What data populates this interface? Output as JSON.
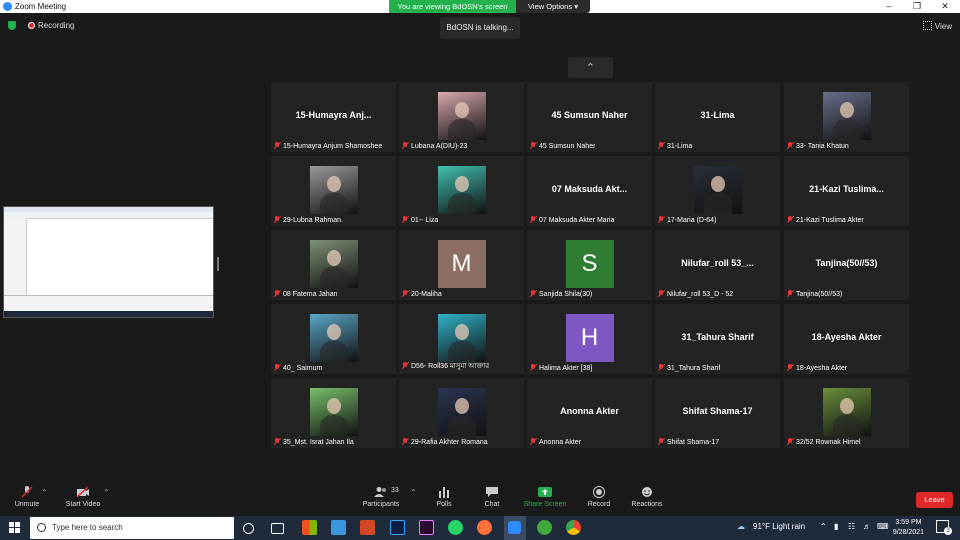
{
  "window": {
    "title": "Zoom Meeting"
  },
  "banner": {
    "text": "You are viewing BdOSN's screen",
    "view_options": "View Options"
  },
  "status": {
    "recording": "Recording",
    "talking": "BdOSN is talking...",
    "view": "View"
  },
  "tiles": [
    {
      "display": "15-Humayra  Anj...",
      "label": "15-Humayra Anjum Shamoshee",
      "type": "name"
    },
    {
      "display": "",
      "label": "Lubana A(DIU)-23",
      "type": "photo",
      "color": "#d9a8b0"
    },
    {
      "display": "45 Sumsun Naher",
      "label": "45 Sumsun Naher",
      "type": "name"
    },
    {
      "display": "31-Lima",
      "label": "31-Lima",
      "type": "name"
    },
    {
      "display": "",
      "label": "33- Tania Khatun",
      "type": "photo",
      "color": "#6a6f8a"
    },
    {
      "display": "",
      "label": "29-Lubna Rahman.",
      "type": "photo",
      "color": "#9a9a9a"
    },
    {
      "display": "",
      "label": "01-- Liza",
      "type": "photo",
      "color": "#3fc1b0"
    },
    {
      "display": "07 Maksuda  Akt...",
      "label": "07 Maksuda Akter Maria",
      "type": "name"
    },
    {
      "display": "",
      "label": "17-Maria (D-64)",
      "type": "photo",
      "color": "#2a2f38"
    },
    {
      "display": "21-Kazi  Tuslima...",
      "label": "21-Kazi Tuslima Akter",
      "type": "name"
    },
    {
      "display": "",
      "label": "08 Fatema Jahan",
      "type": "photo",
      "color": "#7e8f77"
    },
    {
      "display": "M",
      "label": "20-Maliha",
      "type": "initial",
      "color": "#8d6e63"
    },
    {
      "display": "S",
      "label": "Sanjida Shila(30)",
      "type": "initial",
      "color": "#2e7d32"
    },
    {
      "display": "Nilufar_roll  53_...",
      "label": "Nilufar_roll 53_D - 52",
      "type": "name"
    },
    {
      "display": "Tanjina(50//53)",
      "label": "Tanjina(50//53)",
      "type": "name"
    },
    {
      "display": "",
      "label": "40_ Saimum",
      "type": "photo",
      "color": "#5aa7c8"
    },
    {
      "display": "",
      "label": "D56- Roll36 মাসুমা আক্তার",
      "type": "photo",
      "color": "#2fb3c9"
    },
    {
      "display": "H",
      "label": "Halima Akter [38]",
      "type": "initial",
      "color": "#7e57c2"
    },
    {
      "display": "31_Tahura Sharif",
      "label": "31_Tahura Sharif",
      "type": "name"
    },
    {
      "display": "18-Ayesha Akter",
      "label": "18-Ayesha Akter",
      "type": "name"
    },
    {
      "display": "",
      "label": "35_Mst. Israt Jahan Ila",
      "type": "photo",
      "color": "#79c06a"
    },
    {
      "display": "",
      "label": "29-Rafia Akhter Romana",
      "type": "photo",
      "color": "#2c3550"
    },
    {
      "display": "Anonna Akter",
      "label": "Anonna Akter",
      "type": "name"
    },
    {
      "display": "Shifat Shama-17",
      "label": "Shifat Shama-17",
      "type": "name"
    },
    {
      "display": "",
      "label": "32/52 Rownak Himel",
      "type": "photo",
      "color": "#6b8f3c"
    }
  ],
  "toolbar": {
    "unmute": "Unmute",
    "start_video": "Start Video",
    "participants": "Participants",
    "participants_count": "33",
    "polls": "Polls",
    "chat": "Chat",
    "share_screen": "Share Screen",
    "record": "Record",
    "reactions": "Reactions",
    "leave": "Leave"
  },
  "taskbar": {
    "search_placeholder": "Type here to search",
    "weather": "91°F  Light rain",
    "time": "3:59 PM",
    "date": "9/28/2021",
    "notifications": "3"
  },
  "colors": {
    "accent_green": "#22b14c",
    "leave_red": "#e02828",
    "zoom_blue": "#2d8cff"
  }
}
